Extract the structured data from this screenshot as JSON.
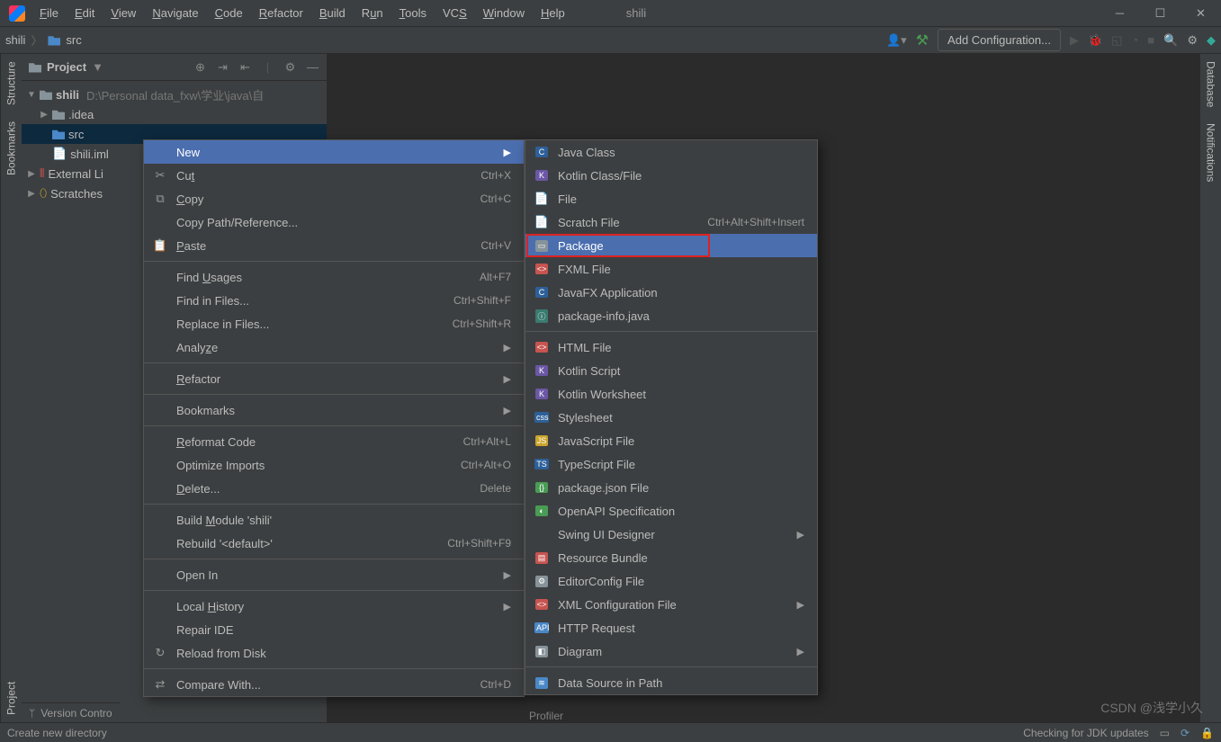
{
  "app": {
    "title": "shili"
  },
  "menubar": [
    "File",
    "Edit",
    "View",
    "Navigate",
    "Code",
    "Refactor",
    "Build",
    "Run",
    "Tools",
    "VCS",
    "Window",
    "Help"
  ],
  "breadcrumb": {
    "root": "shili",
    "child": "src"
  },
  "toolbar": {
    "add_config": "Add Configuration..."
  },
  "project_tool": {
    "title": "Project",
    "tree": {
      "root": "shili",
      "root_path": "D:\\Personal data_fxw\\学业\\java\\自",
      "idea": ".idea",
      "src": "src",
      "iml": "shili.iml",
      "ext": "External Li",
      "scratch": "Scratches"
    }
  },
  "context_menu": [
    {
      "icon": "",
      "label": "New",
      "shortcut": "",
      "arrow": true,
      "hl": true
    },
    {
      "icon": "✂",
      "label": "Cut",
      "u": "t",
      "shortcut": "Ctrl+X"
    },
    {
      "icon": "⧉",
      "label": "Copy",
      "u": "C",
      "shortcut": "Ctrl+C"
    },
    {
      "icon": "",
      "label": "Copy Path/Reference...",
      "shortcut": ""
    },
    {
      "icon": "📋",
      "label": "Paste",
      "u": "P",
      "shortcut": "Ctrl+V"
    },
    {
      "sep": true
    },
    {
      "icon": "",
      "label": "Find Usages",
      "u": "U",
      "shortcut": "Alt+F7"
    },
    {
      "icon": "",
      "label": "Find in Files...",
      "shortcut": "Ctrl+Shift+F"
    },
    {
      "icon": "",
      "label": "Replace in Files...",
      "shortcut": "Ctrl+Shift+R"
    },
    {
      "icon": "",
      "label": "Analyze",
      "u": "z",
      "shortcut": "",
      "arrow": true
    },
    {
      "sep": true
    },
    {
      "icon": "",
      "label": "Refactor",
      "u": "R",
      "shortcut": "",
      "arrow": true
    },
    {
      "sep": true
    },
    {
      "icon": "",
      "label": "Bookmarks",
      "shortcut": "",
      "arrow": true
    },
    {
      "sep": true
    },
    {
      "icon": "",
      "label": "Reformat Code",
      "u": "R",
      "shortcut": "Ctrl+Alt+L"
    },
    {
      "icon": "",
      "label": "Optimize Imports",
      "shortcut": "Ctrl+Alt+O"
    },
    {
      "icon": "",
      "label": "Delete...",
      "u": "D",
      "shortcut": "Delete"
    },
    {
      "sep": true
    },
    {
      "icon": "",
      "label": "Build Module 'shili'",
      "u": "M",
      "shortcut": ""
    },
    {
      "icon": "",
      "label": "Rebuild '<default>'",
      "shortcut": "Ctrl+Shift+F9"
    },
    {
      "sep": true
    },
    {
      "icon": "",
      "label": "Open In",
      "shortcut": "",
      "arrow": true
    },
    {
      "sep": true
    },
    {
      "icon": "",
      "label": "Local History",
      "u": "H",
      "shortcut": "",
      "arrow": true
    },
    {
      "icon": "",
      "label": "Repair IDE",
      "shortcut": ""
    },
    {
      "icon": "↻",
      "label": "Reload from Disk",
      "shortcut": ""
    },
    {
      "sep": true
    },
    {
      "icon": "⇄",
      "label": "Compare With...",
      "shortcut": "Ctrl+D"
    }
  ],
  "new_submenu": [
    {
      "icon": "C",
      "color": "#2d6099",
      "label": "Java Class"
    },
    {
      "icon": "K",
      "color": "#6b57a5",
      "label": "Kotlin Class/File"
    },
    {
      "icon": "📄",
      "color": "",
      "label": "File"
    },
    {
      "icon": "📄",
      "color": "",
      "label": "Scratch File",
      "shortcut": "Ctrl+Alt+Shift+Insert"
    },
    {
      "icon": "▭",
      "color": "#87939a",
      "label": "Package",
      "hl": true
    },
    {
      "icon": "<>",
      "color": "#c75450",
      "label": "FXML File"
    },
    {
      "icon": "C",
      "color": "#2d6099",
      "label": "JavaFX Application"
    },
    {
      "icon": "ⓘ",
      "color": "#3a7a6f",
      "label": "package-info.java"
    },
    {
      "sep": true
    },
    {
      "icon": "<>",
      "color": "#c75450",
      "label": "HTML File"
    },
    {
      "icon": "K",
      "color": "#6b57a5",
      "label": "Kotlin Script"
    },
    {
      "icon": "K",
      "color": "#6b57a5",
      "label": "Kotlin Worksheet"
    },
    {
      "icon": "css",
      "color": "#2d6099",
      "label": "Stylesheet"
    },
    {
      "icon": "JS",
      "color": "#c9a52c",
      "label": "JavaScript File"
    },
    {
      "icon": "TS",
      "color": "#2d6099",
      "label": "TypeScript File"
    },
    {
      "icon": "{}",
      "color": "#499c54",
      "label": "package.json File"
    },
    {
      "icon": "◐",
      "color": "#499c54",
      "label": "OpenAPI Specification"
    },
    {
      "icon": "",
      "color": "",
      "label": "Swing UI Designer",
      "arrow": true
    },
    {
      "icon": "▤",
      "color": "#c75450",
      "label": "Resource Bundle"
    },
    {
      "icon": "⚙",
      "color": "#87939a",
      "label": "EditorConfig File"
    },
    {
      "icon": "<>",
      "color": "#c75450",
      "label": "XML Configuration File",
      "arrow": true
    },
    {
      "icon": "API",
      "color": "#4a88c7",
      "label": "HTTP Request"
    },
    {
      "icon": "◧",
      "color": "#87939a",
      "label": "Diagram",
      "arrow": true
    },
    {
      "sep": true
    },
    {
      "icon": "≋",
      "color": "#4a88c7",
      "label": "Data Source in Path"
    }
  ],
  "left_gutter": [
    "Project",
    "Bookmarks",
    "Structure"
  ],
  "right_gutter": [
    "Database",
    "Notifications"
  ],
  "bottom_tabs": {
    "vc": "Version Contro",
    "profiler": "Profiler"
  },
  "status": {
    "left": "Create new directory",
    "right": "Checking for JDK updates"
  },
  "watermark": "CSDN @浅学小久"
}
